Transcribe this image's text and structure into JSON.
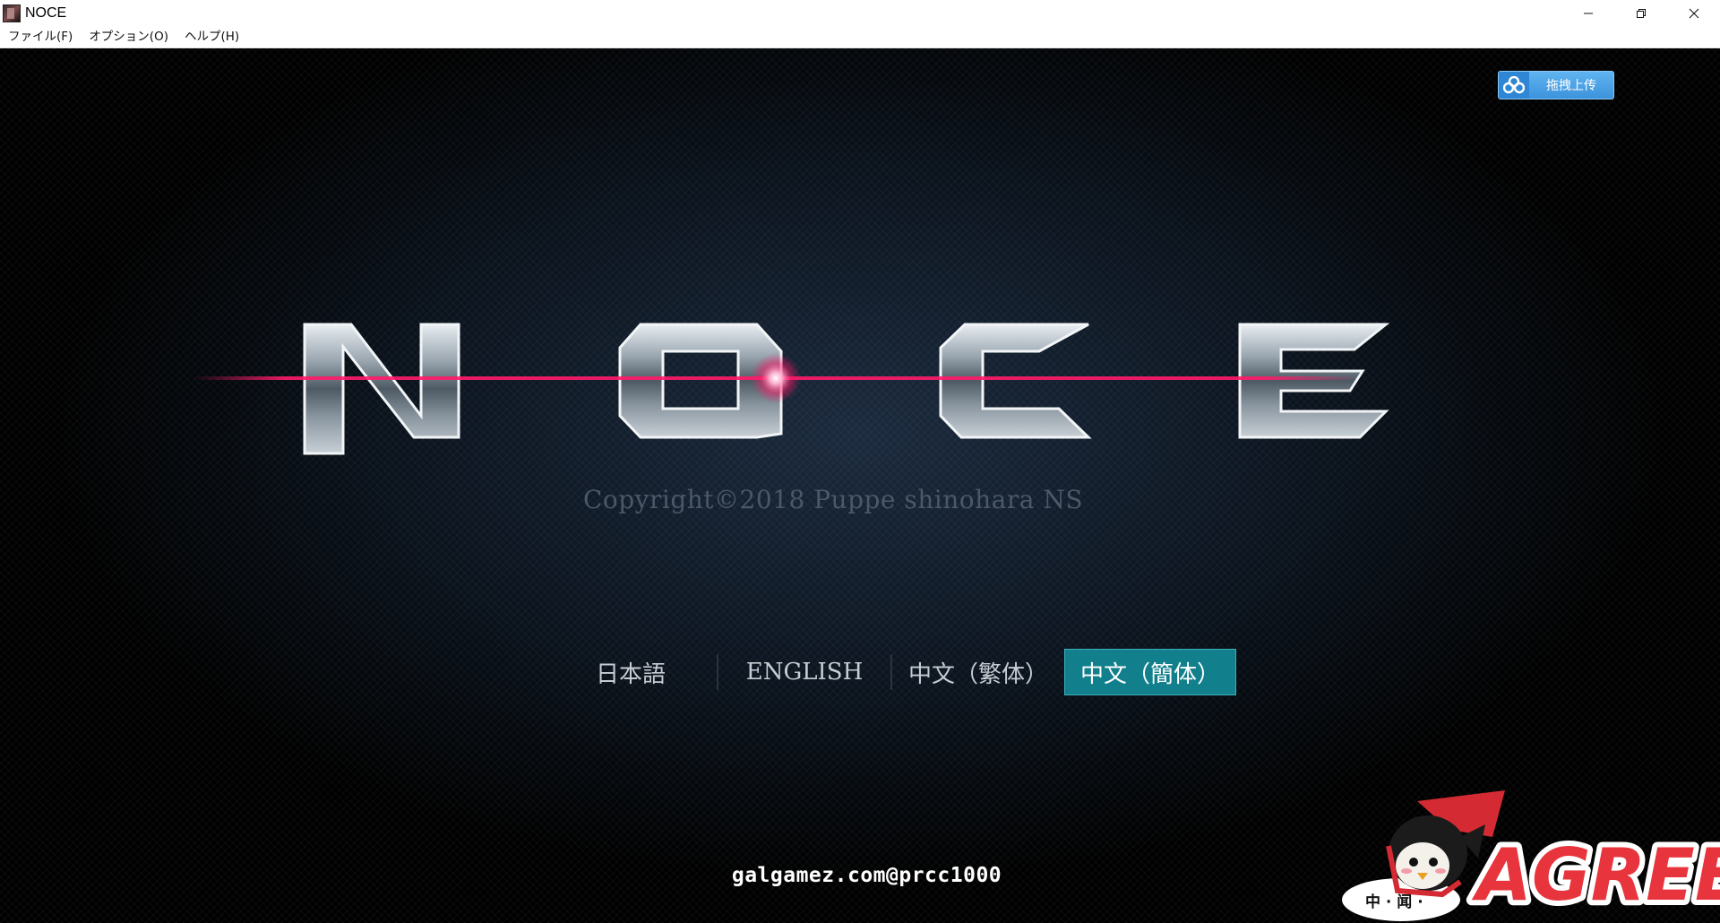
{
  "window": {
    "title": "NOCE",
    "controls": {
      "minimize_icon": "minimize-icon",
      "restore_icon": "restore-icon",
      "close_icon": "close-icon"
    }
  },
  "menubar": {
    "items": [
      "ファイル(F)",
      "オプション(O)",
      "ヘルプ(H)"
    ]
  },
  "upload_button": {
    "label": "拖拽上传",
    "icon": "cloud-upload-icon"
  },
  "logo": {
    "letters": [
      "N",
      "O",
      "C",
      "E"
    ]
  },
  "copyright": "Copyright©2018 Puppe shinohara NS",
  "language_selector": {
    "options": [
      "日本語",
      "ENGLISH",
      "中文（繁体）",
      "中文（簡体）"
    ],
    "selected_index": 3
  },
  "watermark": "galgamez.com@prcc1000",
  "badge": {
    "text": "AGREE",
    "speech": "中 · 闻 ·"
  },
  "colors": {
    "selected_language_bg": "#12808c",
    "laser": "#ff1a6a",
    "upload_button": "#3d93db",
    "badge_red": "#e8343c"
  }
}
